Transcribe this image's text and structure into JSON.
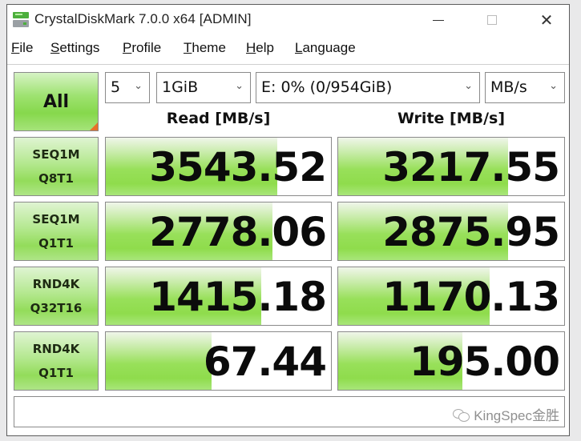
{
  "window": {
    "title": "CrystalDiskMark 7.0.0 x64 [ADMIN]",
    "controls": {
      "minimize": "minimize",
      "maximize": "maximize",
      "close": "✕"
    }
  },
  "menu": [
    {
      "label": "File",
      "accel": "F",
      "rest": "ile"
    },
    {
      "label": "Settings",
      "accel": "S",
      "rest": "ettings"
    },
    {
      "label": "Profile",
      "accel": "P",
      "rest": "rofile"
    },
    {
      "label": "Theme",
      "accel": "T",
      "rest": "heme"
    },
    {
      "label": "Help",
      "accel": "H",
      "rest": "elp"
    },
    {
      "label": "Language",
      "accel": "L",
      "rest": "anguage"
    }
  ],
  "controls": {
    "all_button": "All",
    "count": "5",
    "size": "1GiB",
    "drive": "E: 0% (0/954GiB)",
    "unit": "MB/s",
    "chevron": "⌄"
  },
  "headers": {
    "read": "Read [MB/s]",
    "write": "Write [MB/s]"
  },
  "rows": [
    {
      "line1": "SEQ1M",
      "line2": "Q8T1",
      "read": "3543.52",
      "write": "3217.55",
      "read_fill": 0.76,
      "write_fill": 0.75
    },
    {
      "line1": "SEQ1M",
      "line2": "Q1T1",
      "read": "2778.06",
      "write": "2875.95",
      "read_fill": 0.74,
      "write_fill": 0.75
    },
    {
      "line1": "RND4K",
      "line2": "Q32T16",
      "read": "1415.18",
      "write": "1170.13",
      "read_fill": 0.69,
      "write_fill": 0.67
    },
    {
      "line1": "RND4K",
      "line2": "Q1T1",
      "read": "67.44",
      "write": "195.00",
      "read_fill": 0.47,
      "write_fill": 0.55
    }
  ],
  "comment": {
    "value": ""
  },
  "watermark": "KingSpec金胜",
  "colors": {
    "accent_green": "#8fdc4c",
    "corner_orange": "#e8702a"
  }
}
